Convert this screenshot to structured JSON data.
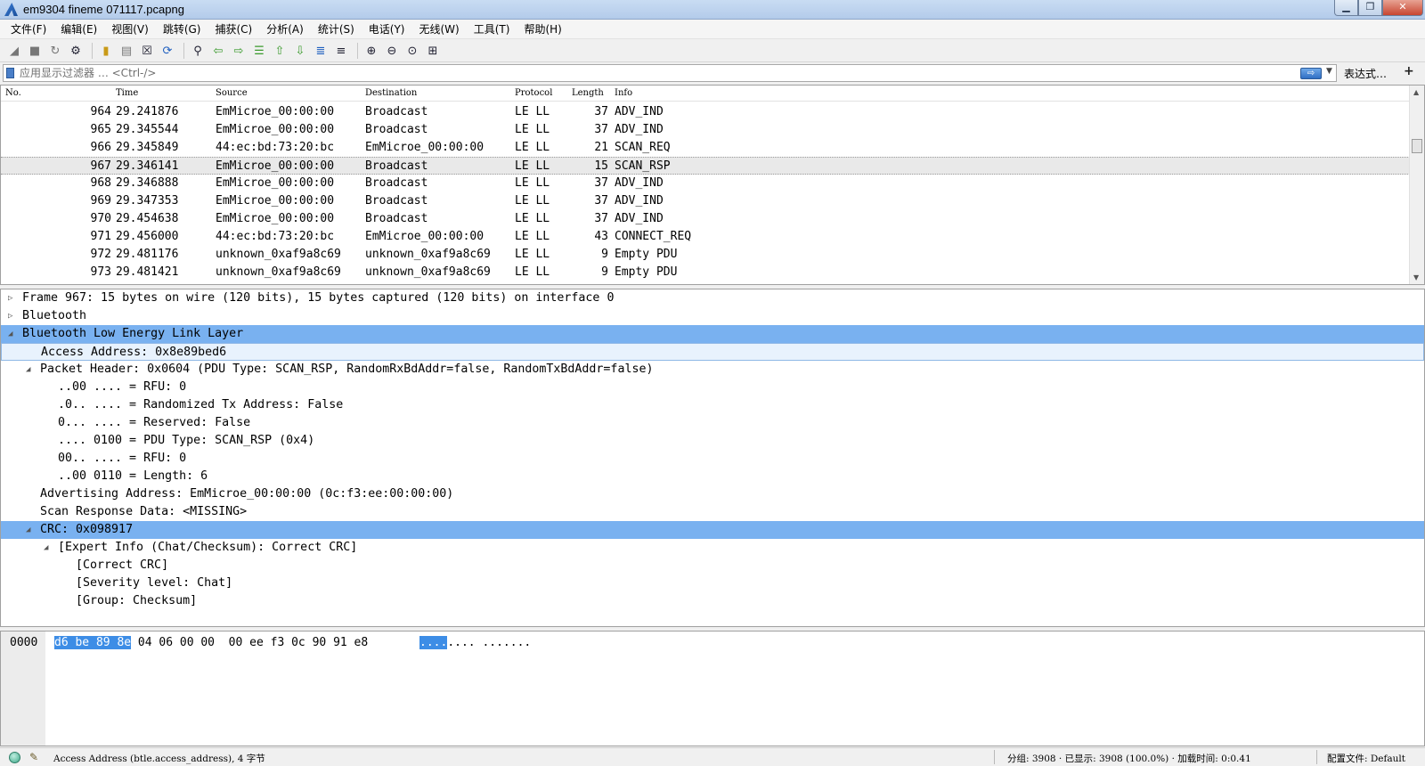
{
  "window": {
    "title": "em9304 fineme 071117.pcapng",
    "buttons": {
      "minimize": "▁",
      "maximize": "❐",
      "close": "✕"
    }
  },
  "menu": [
    "文件(F)",
    "编辑(E)",
    "视图(V)",
    "跳转(G)",
    "捕获(C)",
    "分析(A)",
    "统计(S)",
    "电话(Y)",
    "无线(W)",
    "工具(T)",
    "帮助(H)"
  ],
  "toolbar": {
    "icons": [
      "shark-fin-start-icon",
      "stop-square-icon",
      "restart-shark-fin-icon",
      "capture-options-gear-icon",
      "open-folder-icon",
      "save-file-icon",
      "close-file-icon",
      "reload-icon",
      "find-packet-icon",
      "go-back-icon",
      "go-forward-icon",
      "go-to-packet-icon",
      "go-first-icon",
      "go-last-icon",
      "auto-scroll-icon",
      "colorize-icon",
      "zoom-in-icon",
      "zoom-out-icon",
      "zoom-normal-icon",
      "resize-columns-icon"
    ]
  },
  "filter": {
    "placeholder": "应用显示过滤器 … <Ctrl-/>",
    "expression_label": "表达式…",
    "plus_label": "+",
    "apply_glyph": "⇨",
    "dropdown_glyph": "▼"
  },
  "packet_list": {
    "columns": {
      "no": "No.",
      "time": "Time",
      "source": "Source",
      "destination": "Destination",
      "protocol": "Protocol",
      "length": "Length",
      "info": "Info"
    },
    "rows": [
      {
        "no": "964",
        "time": "29.241876",
        "source": "EmMicroe_00:00:00",
        "destination": "Broadcast",
        "protocol": "LE LL",
        "length": "37",
        "info": "ADV_IND"
      },
      {
        "no": "965",
        "time": "29.345544",
        "source": "EmMicroe_00:00:00",
        "destination": "Broadcast",
        "protocol": "LE LL",
        "length": "37",
        "info": "ADV_IND"
      },
      {
        "no": "966",
        "time": "29.345849",
        "source": "44:ec:bd:73:20:bc",
        "destination": "EmMicroe_00:00:00",
        "protocol": "LE LL",
        "length": "21",
        "info": "SCAN_REQ"
      },
      {
        "no": "967",
        "time": "29.346141",
        "source": "EmMicroe_00:00:00",
        "destination": "Broadcast",
        "protocol": "LE LL",
        "length": "15",
        "info": "SCAN_RSP"
      },
      {
        "no": "968",
        "time": "29.346888",
        "source": "EmMicroe_00:00:00",
        "destination": "Broadcast",
        "protocol": "LE LL",
        "length": "37",
        "info": "ADV_IND"
      },
      {
        "no": "969",
        "time": "29.347353",
        "source": "EmMicroe_00:00:00",
        "destination": "Broadcast",
        "protocol": "LE LL",
        "length": "37",
        "info": "ADV_IND"
      },
      {
        "no": "970",
        "time": "29.454638",
        "source": "EmMicroe_00:00:00",
        "destination": "Broadcast",
        "protocol": "LE LL",
        "length": "37",
        "info": "ADV_IND"
      },
      {
        "no": "971",
        "time": "29.456000",
        "source": "44:ec:bd:73:20:bc",
        "destination": "EmMicroe_00:00:00",
        "protocol": "LE LL",
        "length": "43",
        "info": "CONNECT_REQ"
      },
      {
        "no": "972",
        "time": "29.481176",
        "source": "unknown_0xaf9a8c69",
        "destination": "unknown_0xaf9a8c69",
        "protocol": "LE LL",
        "length": "9",
        "info": "Empty PDU"
      },
      {
        "no": "973",
        "time": "29.481421",
        "source": "unknown_0xaf9a8c69",
        "destination": "unknown_0xaf9a8c69",
        "protocol": "LE LL",
        "length": "9",
        "info": "Empty PDU"
      }
    ],
    "selected_no": "967"
  },
  "details": [
    {
      "text": "Frame 967: 15 bytes on wire (120 bits), 15 bytes captured (120 bits) on interface 0",
      "expander": "▷"
    },
    {
      "text": "Bluetooth",
      "expander": "▷"
    },
    {
      "text": "Bluetooth Low Energy Link Layer",
      "expander": "◢"
    },
    {
      "text": "Access Address: 0x8e89bed6",
      "expander": ""
    },
    {
      "text": "Packet Header: 0x0604 (PDU Type: SCAN_RSP, RandomRxBdAddr=false, RandomTxBdAddr=false)",
      "expander": "◢"
    },
    {
      "text": "..00 .... = RFU: 0",
      "expander": ""
    },
    {
      "text": ".0.. .... = Randomized Tx Address: False",
      "expander": ""
    },
    {
      "text": "0... .... = Reserved: False",
      "expander": ""
    },
    {
      "text": ".... 0100 = PDU Type: SCAN_RSP (0x4)",
      "expander": ""
    },
    {
      "text": "00.. .... = RFU: 0",
      "expander": ""
    },
    {
      "text": "..00 0110 = Length: 6",
      "expander": ""
    },
    {
      "text": "Advertising Address: EmMicroe_00:00:00 (0c:f3:ee:00:00:00)",
      "expander": ""
    },
    {
      "text": "Scan Response Data: <MISSING>",
      "expander": ""
    },
    {
      "text": "CRC: 0x098917",
      "expander": "◢"
    },
    {
      "text": "[Expert Info (Chat/Checksum): Correct CRC]",
      "expander": "◢"
    },
    {
      "text": "[Correct CRC]",
      "expander": ""
    },
    {
      "text": "[Severity level: Chat]",
      "expander": ""
    },
    {
      "text": "[Group: Checksum]",
      "expander": ""
    }
  ],
  "bytes": {
    "offset": "0000",
    "hex_selected": "d6 be 89 8e",
    "hex_rest": " 04 06 00 00  00 ee f3 0c 90 91 e8",
    "ascii_selected": "....",
    "ascii_rest": ".... ......."
  },
  "status": {
    "field": "Access Address (btle.access_address), 4 字节",
    "packets": "分组: 3908 · 已显示: 3908 (100.0%) · 加载时间: 0:0.41",
    "profile": "配置文件: Default"
  },
  "colors": {
    "selection_blue": "#79b1f0",
    "selected_row": "#e9e9e9",
    "byte_highlight": "#3d8de6"
  }
}
